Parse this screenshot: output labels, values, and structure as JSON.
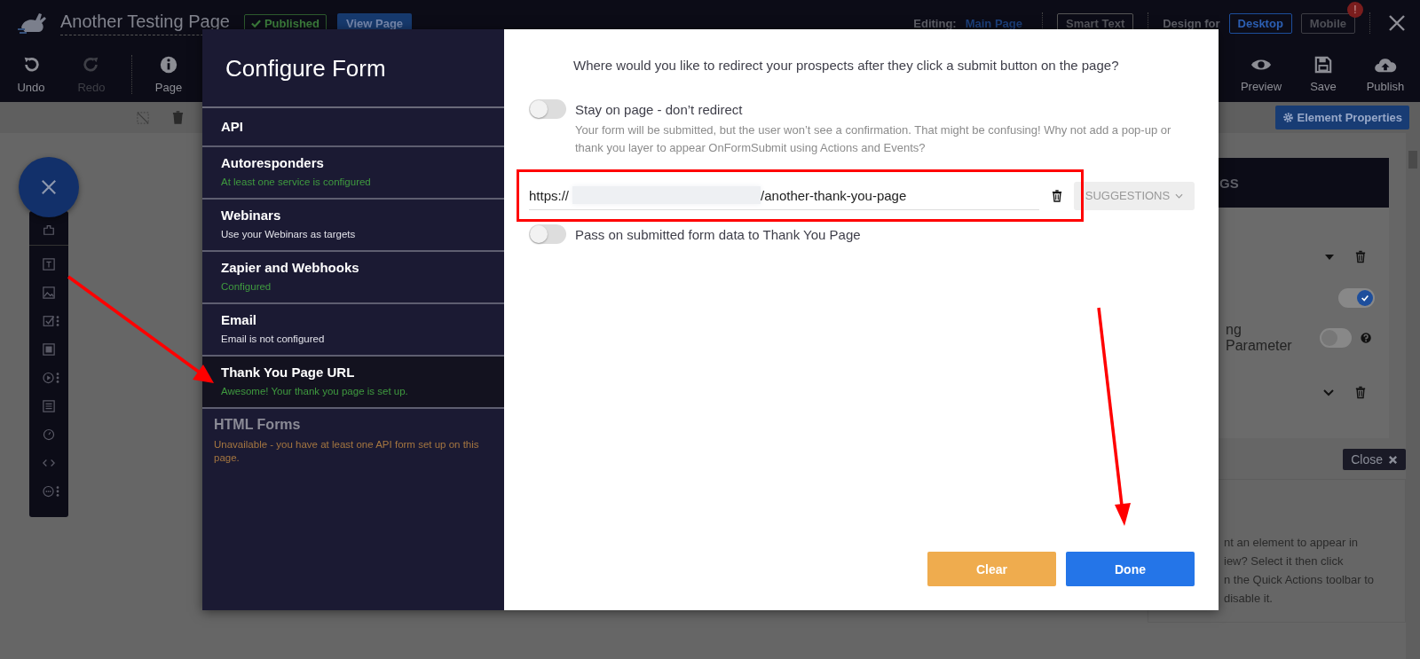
{
  "header": {
    "title": "Another Testing Page",
    "status": "Published",
    "view_button": "View Page",
    "editing_label": "Editing:",
    "editing_page": "Main Page",
    "smart_text": "Smart Text",
    "design_label": "Design for",
    "devices": [
      {
        "label": "Desktop",
        "selected": true
      },
      {
        "label": "Mobile",
        "selected": false,
        "alert": "!"
      }
    ]
  },
  "toolbar": {
    "left": [
      {
        "label": "Undo",
        "disabled": false
      },
      {
        "label": "Redo",
        "disabled": true
      },
      {
        "label": "Page",
        "disabled": false
      }
    ],
    "right": [
      {
        "label": "Preview"
      },
      {
        "label": "Save"
      },
      {
        "label": "Publish"
      }
    ]
  },
  "subtoolbar": {
    "element_properties": "Element Properties"
  },
  "settings_panel": {
    "header": "GS",
    "toggles": [
      {
        "on": true
      },
      {
        "label": "ng Parameter",
        "on": false
      }
    ],
    "close_button": "Close",
    "tip_lines": [
      "nt an element to appear in",
      "iew? Select it then click",
      "n the Quick Actions toolbar to",
      "disable it."
    ]
  },
  "modal": {
    "title": "Configure Form",
    "menu": [
      {
        "title": "API",
        "selected": false,
        "disabled": false
      },
      {
        "title": "Autoresponders",
        "status": "At least one service is configured",
        "color": "#3f9a3f",
        "selected": false,
        "disabled": false
      },
      {
        "title": "Webinars",
        "status": "Use your Webinars as targets",
        "color": "#e3e3ea",
        "selected": false,
        "disabled": false
      },
      {
        "title": "Zapier and Webhooks",
        "status": "Configured",
        "color": "#3f9a3f",
        "selected": false,
        "disabled": false
      },
      {
        "title": "Email",
        "status": "Email is not configured",
        "color": "#e3e3ea",
        "selected": false,
        "disabled": false
      },
      {
        "title": "Thank You Page URL",
        "status": "Awesome! Your thank you page is set up.",
        "color": "#3f9a3f",
        "selected": true,
        "disabled": false
      },
      {
        "title": "HTML Forms",
        "status": "Unavailable - you have at least one API form set up on this page.",
        "color": "#a57640",
        "selected": false,
        "disabled": true
      }
    ],
    "question": "Where would you like to redirect your prospects after they click a submit button on the page?",
    "redirect_toggle": {
      "label": "Stay on page - don’t redirect",
      "on": false,
      "help": "Your form will be submitted, but the user won’t see a confirmation. That might be confusing! Why not add a pop-up or thank you layer to appear OnFormSubmit using Actions and Events?"
    },
    "url": {
      "prefix": "https://",
      "path": "/another-thank-you-page",
      "redacted": true
    },
    "suggestions": {
      "label": "SUGGESTIONS",
      "disabled": true
    },
    "pass_toggle": {
      "label": "Pass on submitted form data to Thank You Page",
      "on": false
    },
    "buttons": [
      {
        "label": "Clear",
        "kind": "secondary"
      },
      {
        "label": "Done",
        "kind": "primary"
      }
    ]
  }
}
